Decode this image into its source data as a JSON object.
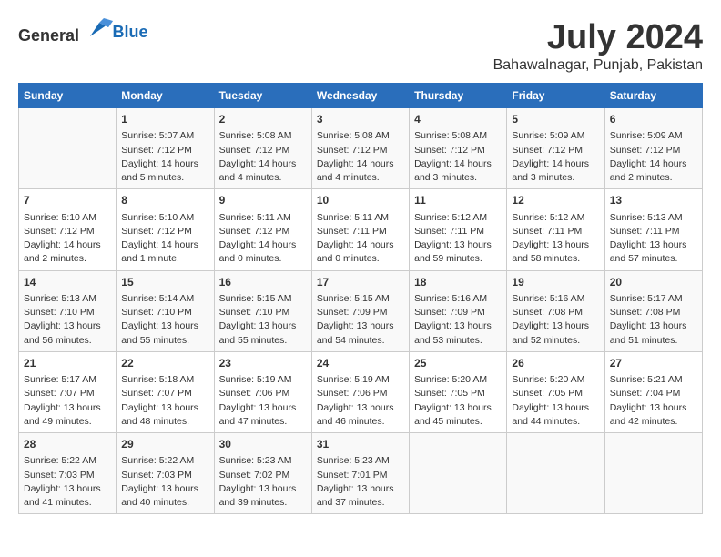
{
  "header": {
    "logo": {
      "general": "General",
      "blue": "Blue"
    },
    "title": "July 2024",
    "location": "Bahawalnagar, Punjab, Pakistan"
  },
  "days_of_week": [
    "Sunday",
    "Monday",
    "Tuesday",
    "Wednesday",
    "Thursday",
    "Friday",
    "Saturday"
  ],
  "weeks": [
    [
      {
        "day": "",
        "content": ""
      },
      {
        "day": "1",
        "content": "Sunrise: 5:07 AM\nSunset: 7:12 PM\nDaylight: 14 hours\nand 5 minutes."
      },
      {
        "day": "2",
        "content": "Sunrise: 5:08 AM\nSunset: 7:12 PM\nDaylight: 14 hours\nand 4 minutes."
      },
      {
        "day": "3",
        "content": "Sunrise: 5:08 AM\nSunset: 7:12 PM\nDaylight: 14 hours\nand 4 minutes."
      },
      {
        "day": "4",
        "content": "Sunrise: 5:08 AM\nSunset: 7:12 PM\nDaylight: 14 hours\nand 3 minutes."
      },
      {
        "day": "5",
        "content": "Sunrise: 5:09 AM\nSunset: 7:12 PM\nDaylight: 14 hours\nand 3 minutes."
      },
      {
        "day": "6",
        "content": "Sunrise: 5:09 AM\nSunset: 7:12 PM\nDaylight: 14 hours\nand 2 minutes."
      }
    ],
    [
      {
        "day": "7",
        "content": "Sunrise: 5:10 AM\nSunset: 7:12 PM\nDaylight: 14 hours\nand 2 minutes."
      },
      {
        "day": "8",
        "content": "Sunrise: 5:10 AM\nSunset: 7:12 PM\nDaylight: 14 hours\nand 1 minute."
      },
      {
        "day": "9",
        "content": "Sunrise: 5:11 AM\nSunset: 7:12 PM\nDaylight: 14 hours\nand 0 minutes."
      },
      {
        "day": "10",
        "content": "Sunrise: 5:11 AM\nSunset: 7:11 PM\nDaylight: 14 hours\nand 0 minutes."
      },
      {
        "day": "11",
        "content": "Sunrise: 5:12 AM\nSunset: 7:11 PM\nDaylight: 13 hours\nand 59 minutes."
      },
      {
        "day": "12",
        "content": "Sunrise: 5:12 AM\nSunset: 7:11 PM\nDaylight: 13 hours\nand 58 minutes."
      },
      {
        "day": "13",
        "content": "Sunrise: 5:13 AM\nSunset: 7:11 PM\nDaylight: 13 hours\nand 57 minutes."
      }
    ],
    [
      {
        "day": "14",
        "content": "Sunrise: 5:13 AM\nSunset: 7:10 PM\nDaylight: 13 hours\nand 56 minutes."
      },
      {
        "day": "15",
        "content": "Sunrise: 5:14 AM\nSunset: 7:10 PM\nDaylight: 13 hours\nand 55 minutes."
      },
      {
        "day": "16",
        "content": "Sunrise: 5:15 AM\nSunset: 7:10 PM\nDaylight: 13 hours\nand 55 minutes."
      },
      {
        "day": "17",
        "content": "Sunrise: 5:15 AM\nSunset: 7:09 PM\nDaylight: 13 hours\nand 54 minutes."
      },
      {
        "day": "18",
        "content": "Sunrise: 5:16 AM\nSunset: 7:09 PM\nDaylight: 13 hours\nand 53 minutes."
      },
      {
        "day": "19",
        "content": "Sunrise: 5:16 AM\nSunset: 7:08 PM\nDaylight: 13 hours\nand 52 minutes."
      },
      {
        "day": "20",
        "content": "Sunrise: 5:17 AM\nSunset: 7:08 PM\nDaylight: 13 hours\nand 51 minutes."
      }
    ],
    [
      {
        "day": "21",
        "content": "Sunrise: 5:17 AM\nSunset: 7:07 PM\nDaylight: 13 hours\nand 49 minutes."
      },
      {
        "day": "22",
        "content": "Sunrise: 5:18 AM\nSunset: 7:07 PM\nDaylight: 13 hours\nand 48 minutes."
      },
      {
        "day": "23",
        "content": "Sunrise: 5:19 AM\nSunset: 7:06 PM\nDaylight: 13 hours\nand 47 minutes."
      },
      {
        "day": "24",
        "content": "Sunrise: 5:19 AM\nSunset: 7:06 PM\nDaylight: 13 hours\nand 46 minutes."
      },
      {
        "day": "25",
        "content": "Sunrise: 5:20 AM\nSunset: 7:05 PM\nDaylight: 13 hours\nand 45 minutes."
      },
      {
        "day": "26",
        "content": "Sunrise: 5:20 AM\nSunset: 7:05 PM\nDaylight: 13 hours\nand 44 minutes."
      },
      {
        "day": "27",
        "content": "Sunrise: 5:21 AM\nSunset: 7:04 PM\nDaylight: 13 hours\nand 42 minutes."
      }
    ],
    [
      {
        "day": "28",
        "content": "Sunrise: 5:22 AM\nSunset: 7:03 PM\nDaylight: 13 hours\nand 41 minutes."
      },
      {
        "day": "29",
        "content": "Sunrise: 5:22 AM\nSunset: 7:03 PM\nDaylight: 13 hours\nand 40 minutes."
      },
      {
        "day": "30",
        "content": "Sunrise: 5:23 AM\nSunset: 7:02 PM\nDaylight: 13 hours\nand 39 minutes."
      },
      {
        "day": "31",
        "content": "Sunrise: 5:23 AM\nSunset: 7:01 PM\nDaylight: 13 hours\nand 37 minutes."
      },
      {
        "day": "",
        "content": ""
      },
      {
        "day": "",
        "content": ""
      },
      {
        "day": "",
        "content": ""
      }
    ]
  ]
}
